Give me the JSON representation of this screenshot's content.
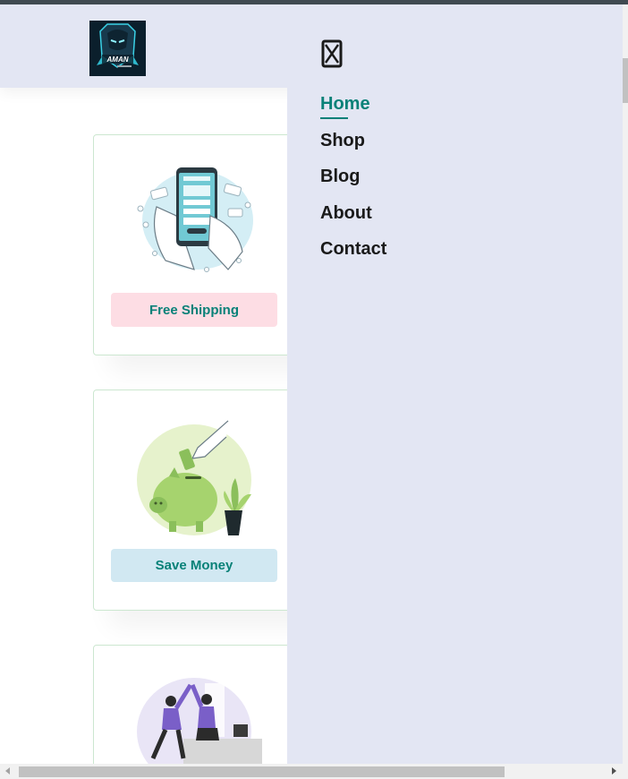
{
  "header": {
    "logo_icon": "brand-logo-hooded-figure"
  },
  "features": [
    {
      "label": "Free Shipping",
      "icon": "payment-phone-illustration",
      "badge_color": "#fddde4"
    },
    {
      "label": "Save Money",
      "icon": "piggy-bank-illustration",
      "badge_color": "#cdebbc"
    },
    {
      "label": "",
      "icon": "high-five-illustration",
      "badge_color": "#d1e8f2"
    }
  ],
  "drawer": {
    "close_icon": "close-icon",
    "nav": [
      {
        "label": "Home",
        "active": true
      },
      {
        "label": "Shop",
        "active": false
      },
      {
        "label": "Blog",
        "active": false
      },
      {
        "label": "About",
        "active": false
      },
      {
        "label": "Contact",
        "active": false
      }
    ]
  },
  "colors": {
    "accent": "#088178",
    "header_bg": "#e3e6f3",
    "card_border": "#cce7d0",
    "save_money_badge": "#d1e8f2"
  }
}
